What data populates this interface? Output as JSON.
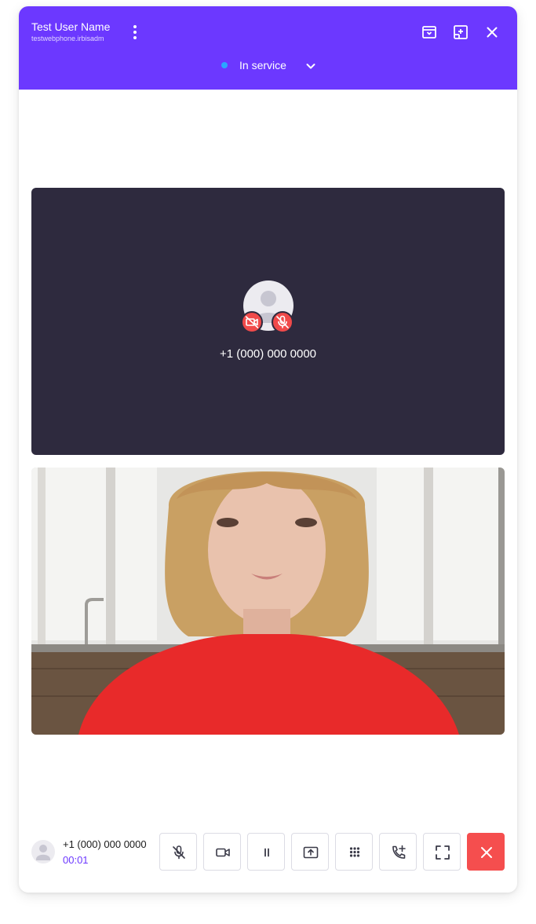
{
  "header": {
    "user_name": "Test User Name",
    "account": "testwebphone.irbisadm",
    "status": "In service",
    "background_color": "#6c38ff",
    "status_dot_color": "#2aa7ff",
    "icons": [
      "more-vertical-icon",
      "archive-icon",
      "add-window-icon",
      "close-icon",
      "chevron-down-icon"
    ]
  },
  "remote_participant": {
    "number": "+1 (000) 000 0000",
    "camera_muted": true,
    "mic_muted": true,
    "tile_color": "#2e2a3e",
    "badge_color": "#f04a4a"
  },
  "local_video": {
    "description_icon": "camera-feed"
  },
  "call_bar": {
    "number": "+1 (000) 000 0000",
    "timer": "00:01",
    "timer_color": "#6c38ff",
    "controls": [
      {
        "name": "mute-microphone",
        "icon": "mic-off-icon"
      },
      {
        "name": "video",
        "icon": "video-camera-icon"
      },
      {
        "name": "hold",
        "icon": "pause-icon"
      },
      {
        "name": "share-screen",
        "icon": "screen-share-icon"
      },
      {
        "name": "dialpad",
        "icon": "keypad-icon"
      },
      {
        "name": "add-call",
        "icon": "phone-add-icon"
      },
      {
        "name": "fullscreen",
        "icon": "fullscreen-icon"
      },
      {
        "name": "hang-up",
        "icon": "close-icon"
      }
    ],
    "hangup_color": "#f54e4e"
  }
}
